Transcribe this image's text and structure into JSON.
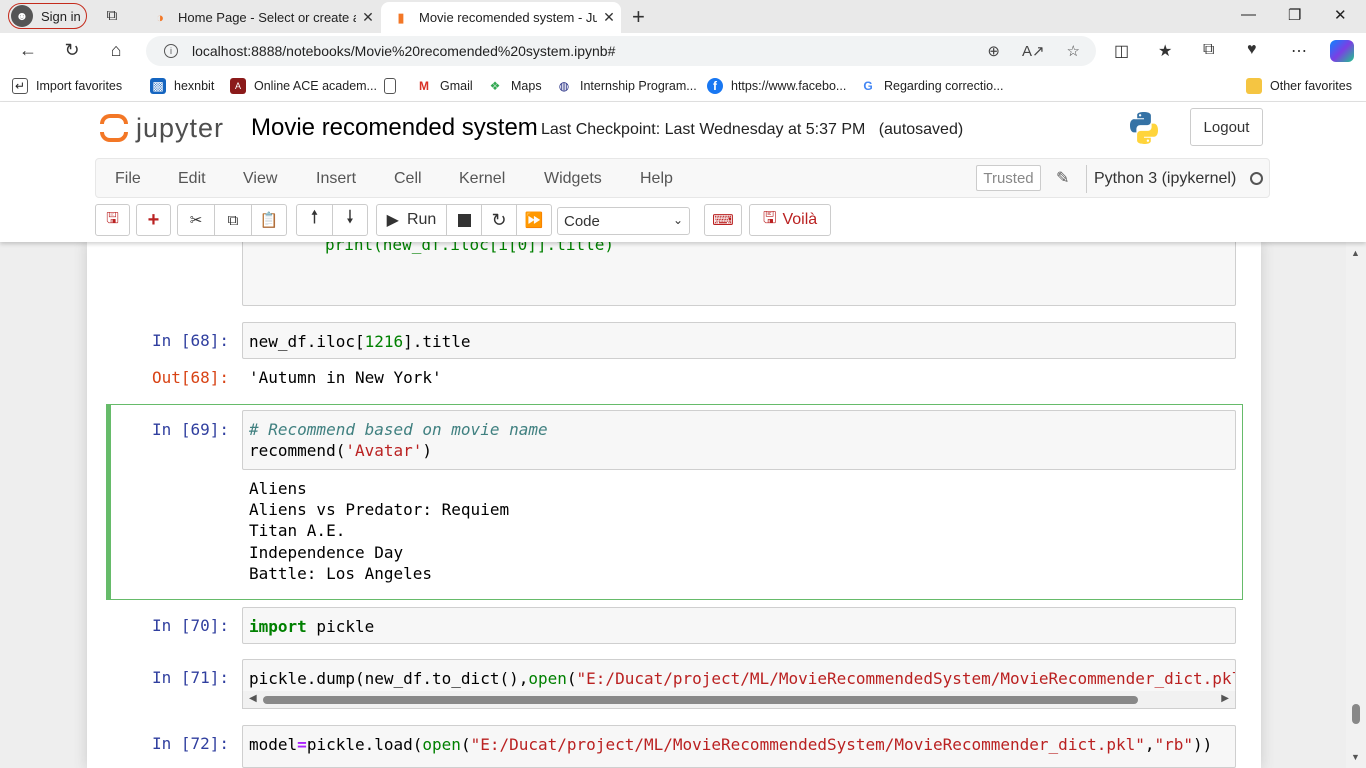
{
  "browser": {
    "signin_label": "Sign in",
    "tabs": [
      {
        "title": "Home Page - Select or create a n",
        "icon": "jupyter-tab-icon"
      },
      {
        "title": "Movie recomended system - Jup",
        "icon": "notebook-tab-icon"
      }
    ],
    "address": "localhost:8888/notebooks/Movie%20recomended%20system.ipynb#",
    "favorites": [
      {
        "label": "Import favorites",
        "icon": "import-icon"
      },
      {
        "label": "hexnbit",
        "icon": "hexnbit-icon"
      },
      {
        "label": "Online ACE academ...",
        "icon": "ace-icon"
      },
      {
        "label": "",
        "icon": "page-icon"
      },
      {
        "label": "Gmail",
        "icon": "gmail-icon"
      },
      {
        "label": "Maps",
        "icon": "maps-icon"
      },
      {
        "label": "Internship Program...",
        "icon": "internship-icon"
      },
      {
        "label": "https://www.facebo...",
        "icon": "facebook-icon"
      },
      {
        "label": "Regarding correctio...",
        "icon": "google-icon"
      },
      {
        "label": "Other favorites",
        "icon": "folder-icon"
      }
    ]
  },
  "jupyter": {
    "logo_text": "jupyter",
    "notebook_name": "Movie recomended system",
    "checkpoint": "Last Checkpoint: Last Wednesday at 5:37 PM",
    "autosaved": "(autosaved)",
    "logout_label": "Logout",
    "menu": [
      "File",
      "Edit",
      "View",
      "Insert",
      "Cell",
      "Kernel",
      "Widgets",
      "Help"
    ],
    "trusted_label": "Trusted",
    "kernel_name": "Python 3 (ipykernel)",
    "toolbar": {
      "run_label": "Run",
      "cell_type": "Code",
      "voila_label": "Voilà"
    }
  },
  "cells": {
    "partial": {
      "code": "print(new_df.iloc[i[0]].title)"
    },
    "c68": {
      "prompt": "In [68]:",
      "code_pre": "new_df.iloc[",
      "code_num": "1216",
      "code_post": "].title",
      "out_prompt": "Out[68]:",
      "output": "'Autumn in New York'"
    },
    "c69": {
      "prompt": "In [69]:",
      "comment": "# Recommend based on movie name",
      "code_pre": "recommend(",
      "code_str": "'Avatar'",
      "code_post": ")",
      "output": [
        "Aliens",
        "Aliens vs Predator: Requiem",
        "Titan A.E.",
        "Independence Day",
        "Battle: Los Angeles"
      ]
    },
    "c70": {
      "prompt": "In [70]:",
      "keyword": "import",
      "code": " pickle"
    },
    "c71": {
      "prompt": "In [71]:",
      "code_pre": "pickle.dump(new_df.to_dict(),",
      "builtin": "open",
      "code_str": "\"E:/Ducat/project/ML/MovieRecommendedSystem/MovieRecommender_dict.pkl"
    },
    "c72": {
      "prompt": "In [72]:",
      "var": "model",
      "eq": "=",
      "code_pre": "pickle.load(",
      "builtin": "open",
      "code_str": "\"E:/Ducat/project/ML/MovieRecommendedSystem/MovieRecommender_dict.pkl\"",
      "comma": ",",
      "mode": "\"rb\"",
      "code_post": "))"
    }
  }
}
